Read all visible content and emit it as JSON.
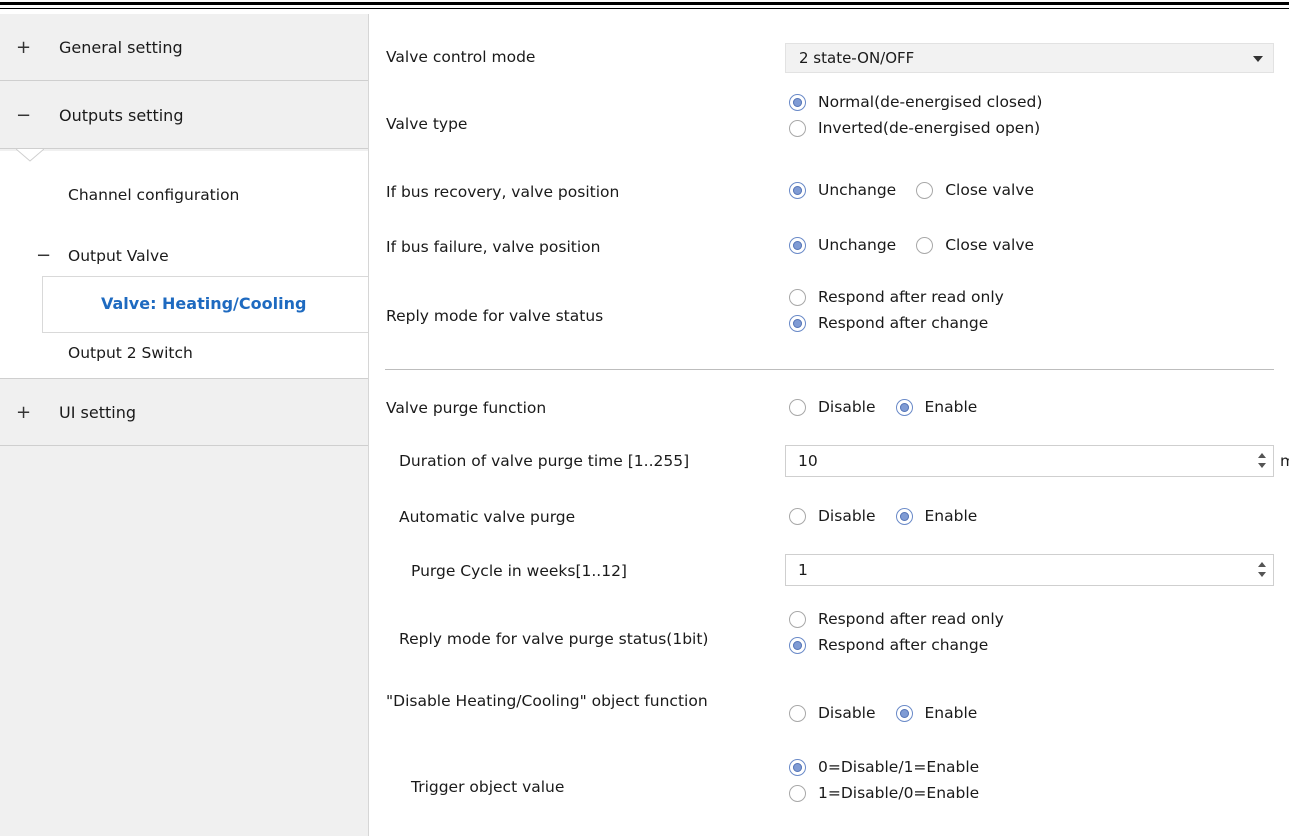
{
  "sidebar": {
    "items": [
      {
        "sign": "+",
        "label": "General setting"
      },
      {
        "sign": "−",
        "label": "Outputs setting"
      },
      {
        "sign": "+",
        "label": "UI setting"
      }
    ],
    "sub": {
      "channel_configuration": "Channel configuration",
      "output_valve_sign": "−",
      "output_valve": "Output Valve",
      "selected": "Valve: Heating/Cooling",
      "output2": "Output 2 Switch"
    }
  },
  "main": {
    "valve_control_mode": {
      "label": "Valve control mode",
      "value": "2 state-ON/OFF"
    },
    "valve_type": {
      "label": "Valve type",
      "options": [
        "Normal(de-energised closed)",
        "Inverted(de-energised open)"
      ],
      "selected": 0
    },
    "bus_recovery": {
      "label": "If bus recovery, valve position",
      "options": [
        "Unchange",
        "Close valve"
      ],
      "selected": 0
    },
    "bus_failure": {
      "label": "If bus failure, valve position",
      "options": [
        "Unchange",
        "Close valve"
      ],
      "selected": 0
    },
    "reply_mode": {
      "label": "Reply mode for valve status",
      "options": [
        "Respond after read only",
        "Respond after change"
      ],
      "selected": 1
    },
    "purge_function": {
      "label": "Valve purge function",
      "options": [
        "Disable",
        "Enable"
      ],
      "selected": 1
    },
    "purge_duration": {
      "label": "Duration of valve purge time [1..255]",
      "value": "10",
      "unit": "min"
    },
    "auto_purge": {
      "label": "Automatic valve purge",
      "options": [
        "Disable",
        "Enable"
      ],
      "selected": 1
    },
    "purge_cycle": {
      "label": "Purge Cycle in weeks[1..12]",
      "value": "1"
    },
    "purge_reply": {
      "label": "Reply mode for valve purge status(1bit)",
      "options": [
        "Respond after read only",
        "Respond after change"
      ],
      "selected": 1
    },
    "disable_hc": {
      "label": "\"Disable Heating/Cooling\" object function",
      "options": [
        "Disable",
        "Enable"
      ],
      "selected": 1
    },
    "trigger_value": {
      "label": "Trigger object value",
      "options": [
        "0=Disable/1=Enable",
        "1=Disable/0=Enable"
      ],
      "selected": 0
    }
  }
}
